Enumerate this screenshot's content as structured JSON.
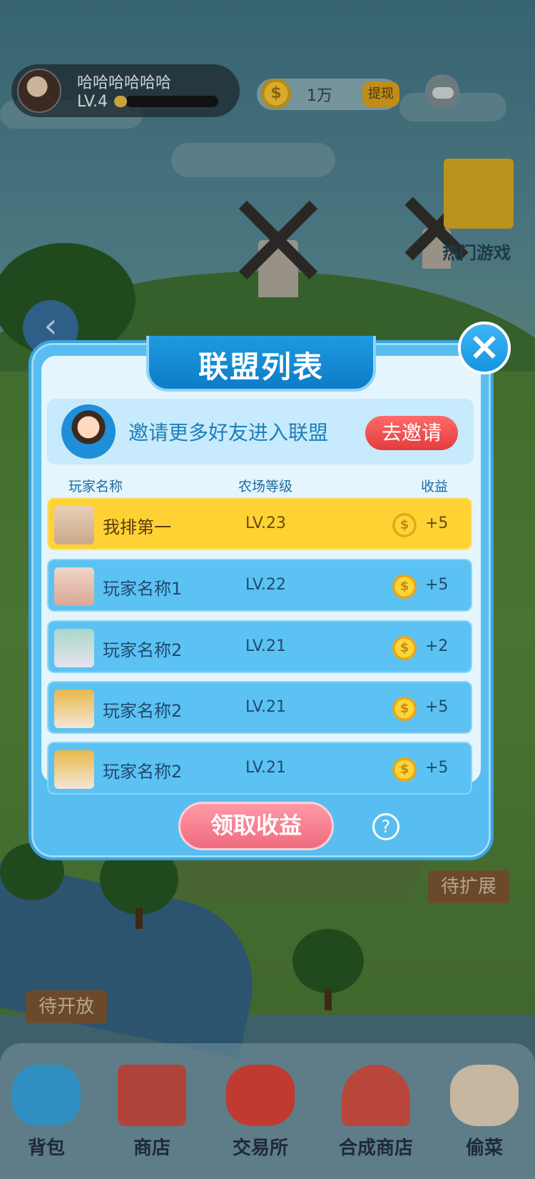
{
  "header": {
    "player_name": "哈哈哈哈哈哈",
    "player_level": "LV.4",
    "coin_amount": "1万",
    "withdraw_label": "提现",
    "hot_games_label": "热门游戏"
  },
  "side_labels": {
    "expand": "待扩展",
    "open": "待开放"
  },
  "modal": {
    "title": "联盟列表",
    "close_icon": "close-icon",
    "invite": {
      "text": "邀请更多好友进入联盟",
      "button": "去邀请"
    },
    "columns": {
      "name": "玩家名称",
      "level": "农场等级",
      "income": "收益"
    },
    "rows": [
      {
        "name": "我排第一",
        "level": "LV.23",
        "income": "+5"
      },
      {
        "name": "玩家名称1",
        "level": "LV.22",
        "income": "+5"
      },
      {
        "name": "玩家名称2",
        "level": "LV.21",
        "income": "+2"
      },
      {
        "name": "玩家名称2",
        "level": "LV.21",
        "income": "+5"
      },
      {
        "name": "玩家名称2",
        "level": "LV.21",
        "income": "+5"
      }
    ],
    "claim_button": "领取收益",
    "help_symbol": "?"
  },
  "bottom_nav": [
    {
      "label": "背包",
      "icon": "backpack-icon"
    },
    {
      "label": "商店",
      "icon": "shop-icon"
    },
    {
      "label": "交易所",
      "icon": "money-bag-icon"
    },
    {
      "label": "合成商店",
      "icon": "house-icon"
    },
    {
      "label": "偷菜",
      "icon": "glove-icon"
    }
  ],
  "colors": {
    "modal_bg": "#58bdf0",
    "highlight_row": "#ffd234",
    "invite_button": "#e43c3c",
    "claim_button": "#f06a7e"
  }
}
